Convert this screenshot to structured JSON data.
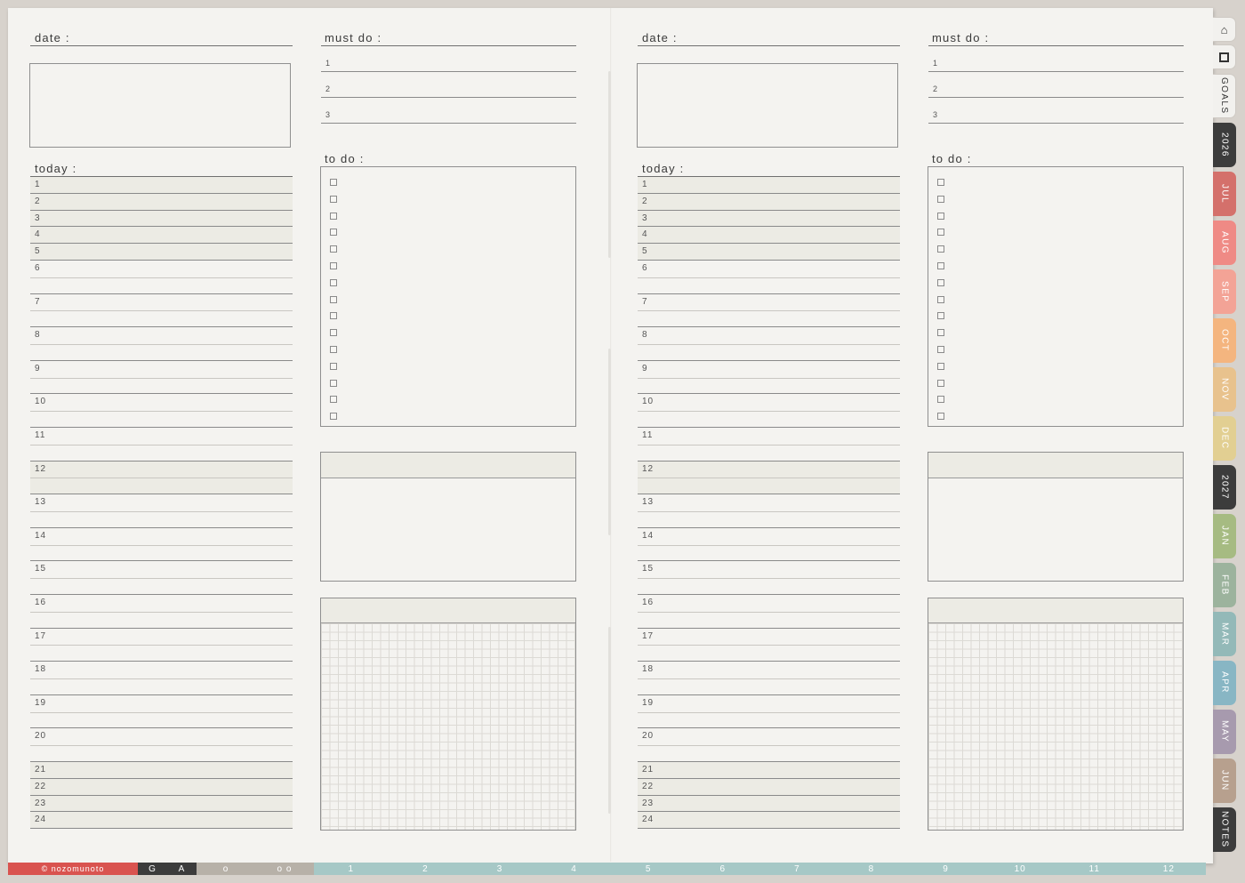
{
  "labels": {
    "date": "date :",
    "must_do": "must do :",
    "today": "today :",
    "to_do": "to do :"
  },
  "must_items": [
    "1",
    "2",
    "3"
  ],
  "hours": [
    "1",
    "2",
    "3",
    "4",
    "5",
    "6",
    "7",
    "8",
    "9",
    "10",
    "11",
    "12",
    "13",
    "14",
    "15",
    "16",
    "17",
    "18",
    "19",
    "20",
    "21",
    "22",
    "23",
    "24"
  ],
  "todo_count": 15,
  "side_tabs": [
    {
      "label": "GOALS",
      "color": "#f2f1ee",
      "text": "light"
    },
    {
      "label": "2026",
      "color": "#3c3c3c",
      "text": "dark"
    },
    {
      "label": "JUL",
      "color": "#d4706b",
      "text": "dark"
    },
    {
      "label": "AUG",
      "color": "#ef8a85",
      "text": "dark"
    },
    {
      "label": "SEP",
      "color": "#f3a396",
      "text": "dark"
    },
    {
      "label": "OCT",
      "color": "#f4b57f",
      "text": "dark"
    },
    {
      "label": "NOV",
      "color": "#e8c28d",
      "text": "dark"
    },
    {
      "label": "DEC",
      "color": "#e2cf92",
      "text": "dark"
    },
    {
      "label": "2027",
      "color": "#3c3c3c",
      "text": "dark"
    },
    {
      "label": "JAN",
      "color": "#a6bb82",
      "text": "dark"
    },
    {
      "label": "FEB",
      "color": "#9cb39d",
      "text": "dark"
    },
    {
      "label": "MAR",
      "color": "#93b9b8",
      "text": "dark"
    },
    {
      "label": "APR",
      "color": "#88b6c4",
      "text": "dark"
    },
    {
      "label": "MAY",
      "color": "#a79aae",
      "text": "dark"
    },
    {
      "label": "JUN",
      "color": "#b7a08e",
      "text": "dark"
    },
    {
      "label": "NOTES",
      "color": "#3c3c3c",
      "text": "dark"
    }
  ],
  "bottom_bar": {
    "brand": "© nozomunoto",
    "segments": [
      {
        "label": "G",
        "color": "#3c3c3c",
        "text": "light"
      },
      {
        "label": "A",
        "color": "#3c3c3c",
        "text": "light"
      },
      {
        "label": "o",
        "color": "#b7b1a8",
        "text": "light"
      },
      {
        "label": "o o",
        "color": "#b7b1a8",
        "text": "light"
      },
      {
        "label": "1",
        "color": "#a6c8c6",
        "text": "light"
      },
      {
        "label": "2",
        "color": "#a6c8c6",
        "text": "light"
      },
      {
        "label": "3",
        "color": "#a6c8c6",
        "text": "light"
      },
      {
        "label": "4",
        "color": "#a6c8c6",
        "text": "light"
      },
      {
        "label": "5",
        "color": "#a6c8c6",
        "text": "light"
      },
      {
        "label": "6",
        "color": "#a6c8c6",
        "text": "light"
      },
      {
        "label": "7",
        "color": "#a6c8c6",
        "text": "light"
      },
      {
        "label": "8",
        "color": "#a6c8c6",
        "text": "light"
      },
      {
        "label": "9",
        "color": "#a6c8c6",
        "text": "light"
      },
      {
        "label": "10",
        "color": "#a6c8c6",
        "text": "light"
      },
      {
        "label": "11",
        "color": "#a6c8c6",
        "text": "light"
      },
      {
        "label": "12",
        "color": "#a6c8c6",
        "text": "light"
      }
    ]
  },
  "colors": {
    "brand_red": "#d9534f",
    "paper": "#f4f3f0",
    "row_tint": "#ecebe4"
  }
}
